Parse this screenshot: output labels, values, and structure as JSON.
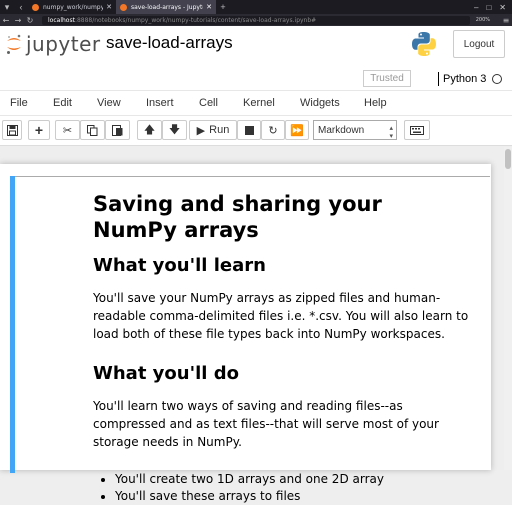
{
  "browser": {
    "tabs": [
      {
        "label": "numpy_work/numpy_no",
        "active": false
      },
      {
        "label": "save-load-arrays - Jupyter",
        "active": true
      }
    ],
    "url_host": "localhost",
    "url_path": ":8888/notebooks/numpy_work/numpy-tutorials/content/save-load-arrays.ipynb#",
    "zoom": "200%"
  },
  "header": {
    "logo_text": "jupyter",
    "notebook_title": "save-load-arrays",
    "logout_label": "Logout",
    "trusted_label": "Trusted",
    "kernel_name": "Python 3"
  },
  "menu": [
    "File",
    "Edit",
    "View",
    "Insert",
    "Cell",
    "Kernel",
    "Widgets",
    "Help"
  ],
  "toolbar": {
    "run_label": "Run",
    "cell_type": "Markdown"
  },
  "cell": {
    "h1": "Saving and sharing your NumPy arrays",
    "h2_learn": "What you'll learn",
    "p_learn": "You'll save your NumPy arrays as zipped files and human-readable comma-delimited files i.e. *.csv. You will also learn to load both of these file types back into NumPy workspaces.",
    "h2_do": "What you'll do",
    "p_do": "You'll learn two ways of saving and reading files--as compressed and as text files--that will serve most of your storage needs in NumPy.",
    "bullets": [
      "You'll create two 1D arrays and one 2D array",
      "You'll save these arrays to files"
    ]
  },
  "colors": {
    "jupyter_orange": "#f37726",
    "selected_cell_bar": "#42a5f5"
  }
}
